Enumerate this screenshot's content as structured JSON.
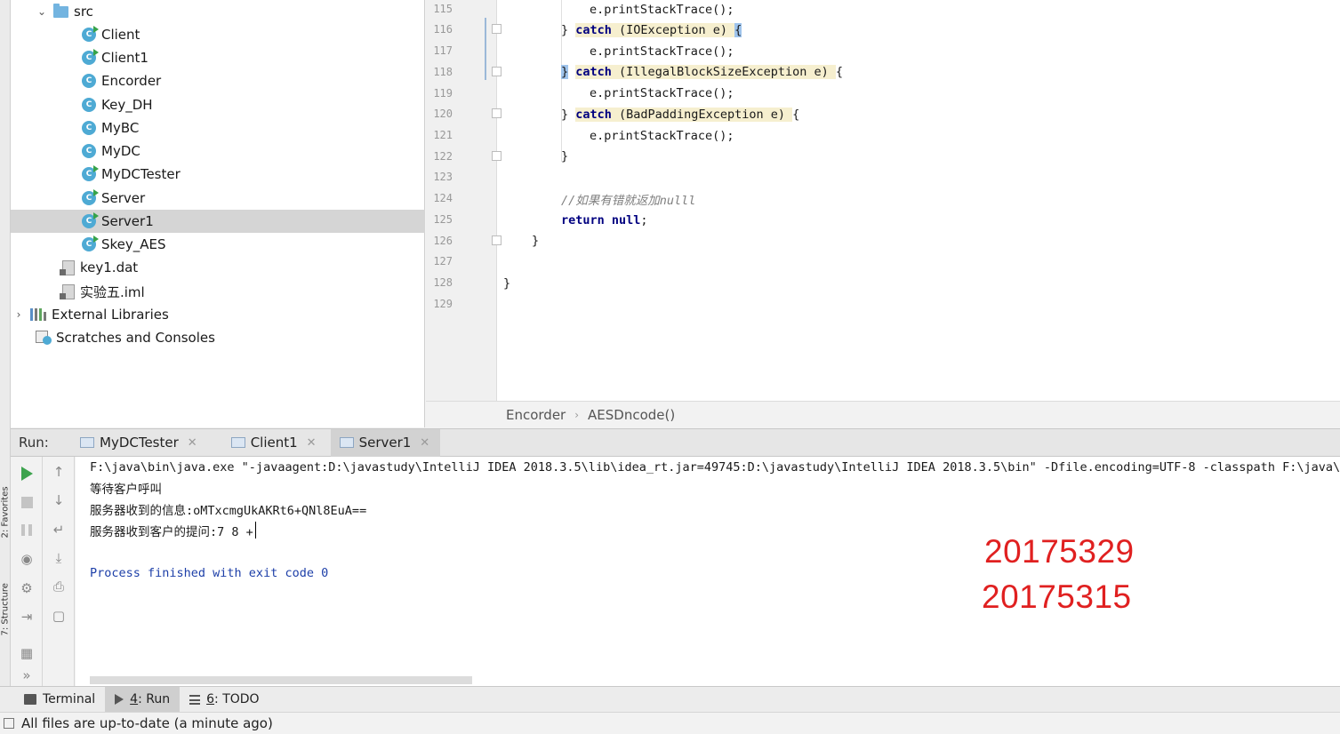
{
  "side_tabs": {
    "favorites": "2: Favorites",
    "structure": "7: Structure"
  },
  "project_tree": {
    "items": [
      {
        "label": "src",
        "kind": "folder",
        "expanded": true
      },
      {
        "label": "Client",
        "kind": "class-runnable"
      },
      {
        "label": "Client1",
        "kind": "class-runnable"
      },
      {
        "label": "Encorder",
        "kind": "class"
      },
      {
        "label": "Key_DH",
        "kind": "class"
      },
      {
        "label": "MyBC",
        "kind": "class"
      },
      {
        "label": "MyDC",
        "kind": "class"
      },
      {
        "label": "MyDCTester",
        "kind": "class-runnable"
      },
      {
        "label": "Server",
        "kind": "class-runnable"
      },
      {
        "label": "Server1",
        "kind": "class-runnable",
        "selected": true
      },
      {
        "label": "Skey_AES",
        "kind": "class-runnable"
      },
      {
        "label": "key1.dat",
        "kind": "file"
      },
      {
        "label": "实验五.iml",
        "kind": "file"
      },
      {
        "label": "External Libraries",
        "kind": "library"
      },
      {
        "label": "Scratches and Consoles",
        "kind": "scratch"
      }
    ]
  },
  "editor": {
    "line_numbers": [
      "115",
      "116",
      "117",
      "118",
      "119",
      "120",
      "121",
      "122",
      "123",
      "124",
      "125",
      "126",
      "127",
      "128",
      "129"
    ],
    "lines": {
      "l115": "e.printStackTrace();",
      "l116_brace": "}",
      "l116_kw": "catch",
      "l116_rest": " (IOException e) ",
      "l116_open": "{",
      "l117": "e.printStackTrace();",
      "l118_brace": "}",
      "l118_kw": "catch",
      "l118_rest": " (IllegalBlockSizeException e) ",
      "l118_open": "{",
      "l119": "e.printStackTrace();",
      "l120_brace": "} ",
      "l120_kw": "catch",
      "l120_rest": " (BadPaddingException e) ",
      "l120_open": "{",
      "l121": "e.printStackTrace();",
      "l122": "}",
      "l124": "//如果有错就返加nulll",
      "l125_kw": "return null",
      "l125_rest": ";",
      "l126": "}",
      "l128": "}"
    },
    "breadcrumb": {
      "class": "Encorder",
      "method": "AESDncode()"
    }
  },
  "run_panel": {
    "title": "Run:",
    "tabs": [
      {
        "label": "MyDCTester",
        "active": false
      },
      {
        "label": "Client1",
        "active": false
      },
      {
        "label": "Server1",
        "active": true
      }
    ],
    "console": {
      "command": "F:\\java\\bin\\java.exe \"-javaagent:D:\\javastudy\\IntelliJ IDEA 2018.3.5\\lib\\idea_rt.jar=49745:D:\\javastudy\\IntelliJ IDEA 2018.3.5\\bin\" -Dfile.encoding=UTF-8 -classpath F:\\java\\jre",
      "line1": "等待客户呼叫",
      "line2": "服务器收到的信息:oMTxcmgUkAKRt6+QNl8EuA==",
      "line3": "服务器收到客户的提问:7 8 +",
      "line4": "Process finished with exit code 0"
    },
    "annotations": [
      "20175329",
      "20175315"
    ]
  },
  "tool_window_bar": {
    "terminal": "Terminal",
    "run_num": "4",
    "run_rest": ": Run",
    "todo_num": "6",
    "todo_rest": ": TODO"
  },
  "status_bar": {
    "message": "All files are up-to-date (a minute ago)"
  },
  "colors": {
    "annotation_red": "#e02020",
    "keyword": "#000080",
    "selected_row": "#d5d5d5"
  }
}
